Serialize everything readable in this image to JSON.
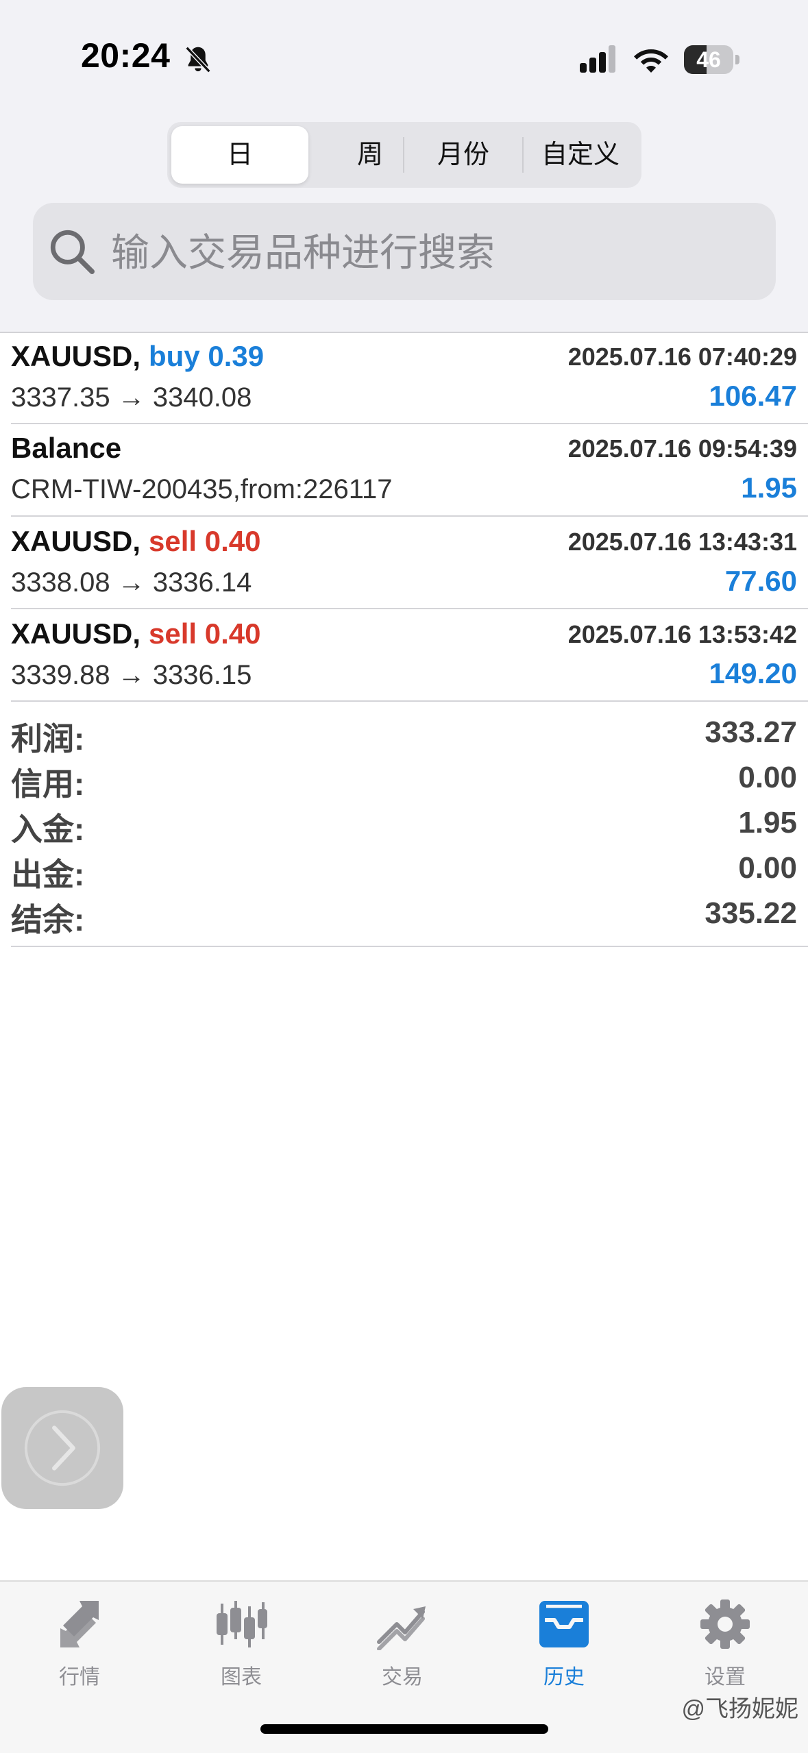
{
  "status": {
    "time": "20:24",
    "battery": "46",
    "battery_level": 0.46
  },
  "segments": [
    {
      "label": "日",
      "active": true
    },
    {
      "label": "周",
      "active": false
    },
    {
      "label": "月份",
      "active": false
    },
    {
      "label": "自定义",
      "active": false
    }
  ],
  "search": {
    "placeholder": "输入交易品种进行搜索",
    "icon": "search-icon"
  },
  "deals": [
    {
      "symbol": "XAUUSD,",
      "direction": "buy 0.39",
      "date": "2025.07.16 07:40:29",
      "prices": "3337.35 → 3340.08",
      "profit": "106.47"
    },
    {
      "symbol": "Balance",
      "direction": "",
      "date": "2025.07.16 09:54:39",
      "prices": "CRM-TIW-200435,from:226117",
      "profit": "1.95"
    },
    {
      "symbol": "XAUUSD,",
      "direction": "sell 0.40",
      "date": "2025.07.16 13:43:31",
      "prices": "3338.08 → 3336.14",
      "profit": "77.60"
    },
    {
      "symbol": "XAUUSD,",
      "direction": "sell 0.40",
      "date": "2025.07.16 13:53:42",
      "prices": "3339.88 → 3336.15",
      "profit": "149.20"
    }
  ],
  "totals": [
    {
      "label": "利润:",
      "value": "333.27"
    },
    {
      "label": "信用:",
      "value": "0.00"
    },
    {
      "label": "入金:",
      "value": "1.95"
    },
    {
      "label": "出金:",
      "value": "0.00"
    },
    {
      "label": "结余:",
      "value": "335.22"
    }
  ],
  "tabs": [
    {
      "label": "行情",
      "icon": "quotes-icon",
      "active": false
    },
    {
      "label": "图表",
      "icon": "chart-icon",
      "active": false
    },
    {
      "label": "交易",
      "icon": "trade-icon",
      "active": false
    },
    {
      "label": "历史",
      "icon": "history-icon",
      "active": true
    },
    {
      "label": "设置",
      "icon": "gear-icon",
      "active": false
    }
  ],
  "watermark": "@飞扬妮妮",
  "colors": {
    "accent": "#1a7fd9",
    "sell": "#d8392b",
    "inactive": "#8e8e93"
  }
}
